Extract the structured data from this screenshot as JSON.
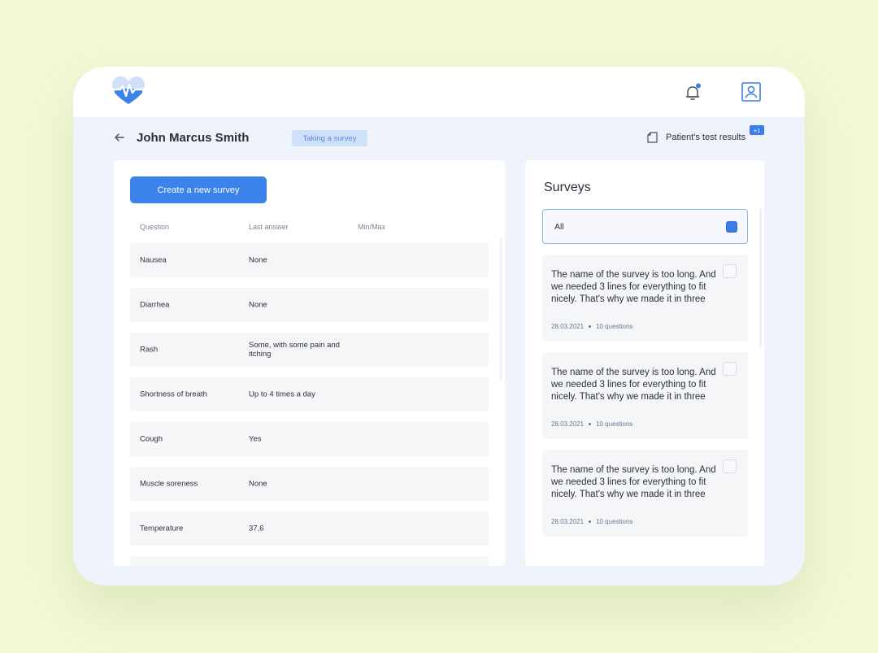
{
  "colors": {
    "accent": "#3b82ea",
    "page_bg": "#f1f8d6",
    "app_bg": "#eef3fc",
    "badge_bg": "#cfe0fa"
  },
  "header": {
    "logo_icon": "heart-pulse-icon",
    "notification_icon": "bell-icon",
    "profile_icon": "user-profile-icon"
  },
  "patient": {
    "name": "John Marcus Smith",
    "status_badge": "Taking a survey",
    "test_results_label": "Patient's test results",
    "test_results_count": "+1"
  },
  "questions": {
    "create_button": "Create a new survey",
    "columns": [
      "Question",
      "Last answer",
      "Min/Max"
    ],
    "rows": [
      {
        "question": "Nausea",
        "answer": "None"
      },
      {
        "question": "Diarrhea",
        "answer": "None"
      },
      {
        "question": "Rash",
        "answer": "Some, with some pain and itching"
      },
      {
        "question": "Shortness of breath",
        "answer": "Up to 4 times a day"
      },
      {
        "question": "Cough",
        "answer": "Yes"
      },
      {
        "question": "Muscle soreness",
        "answer": "None"
      },
      {
        "question": "Temperature",
        "answer": "37,6"
      }
    ]
  },
  "surveys": {
    "title": "Surveys",
    "filter_all": "All",
    "items": [
      {
        "title": "The name of the survey is too long. And we needed 3 lines for everything to fit nicely. That's why we made it in three",
        "date": "28.03.2021",
        "questions": "10 questions"
      },
      {
        "title": "The name of the survey is too long. And we needed 3 lines for everything to fit nicely. That's why we made it in three",
        "date": "28.03.2021",
        "questions": "10 questions"
      },
      {
        "title": "The name of the survey is too long. And we needed 3 lines for everything to fit nicely. That's why we made it in three",
        "date": "28.03.2021",
        "questions": "10 questions"
      }
    ]
  }
}
